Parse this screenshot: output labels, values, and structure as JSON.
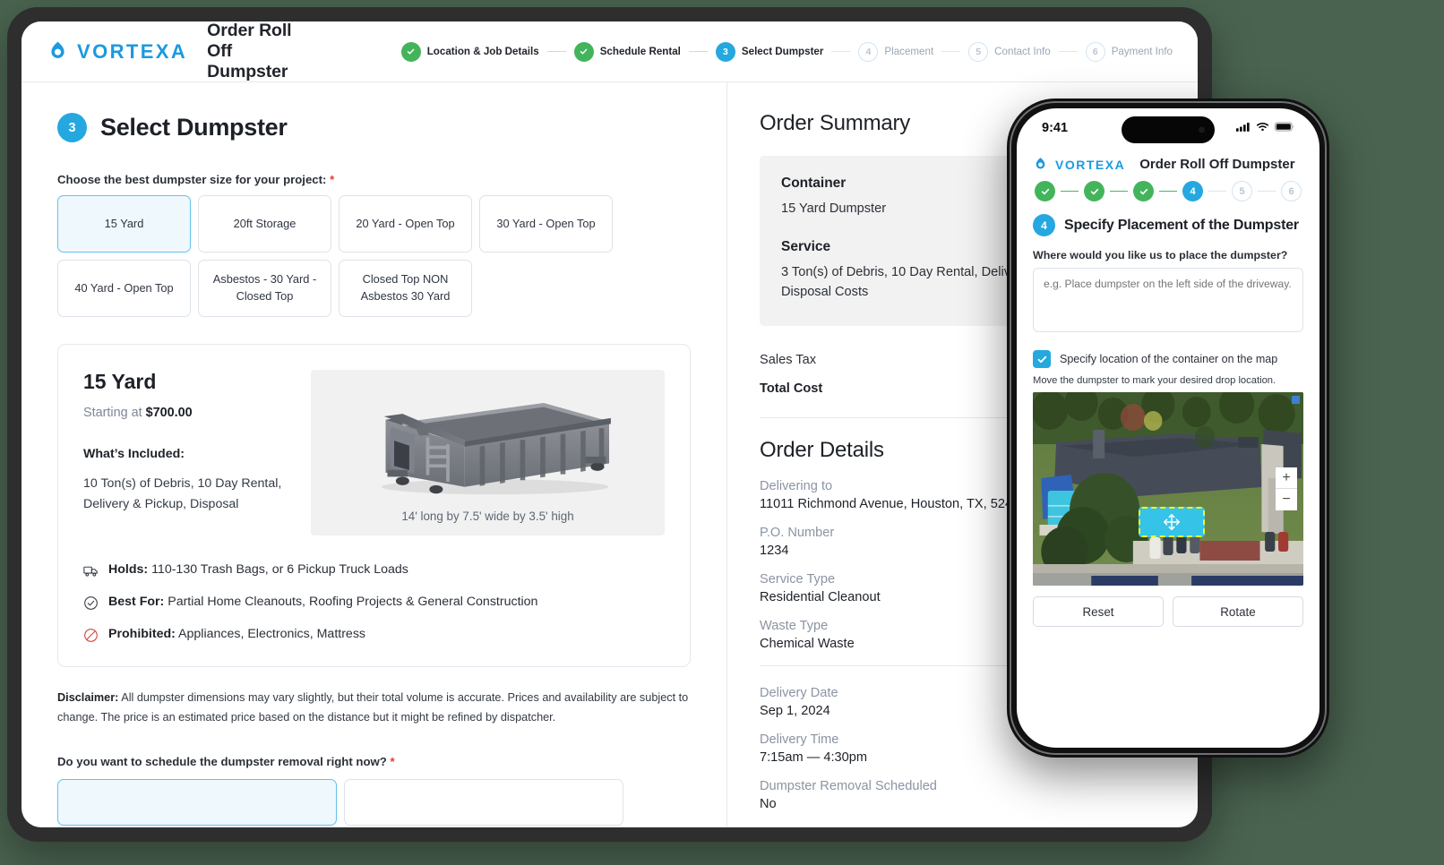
{
  "brand": {
    "name": "VORTEXA",
    "logo_icon": "vortexa-drop-icon"
  },
  "desktop": {
    "app_title": "Order Roll Off Dumpster",
    "stepper": [
      {
        "num": "1",
        "label": "Location & Job Details",
        "state": "done"
      },
      {
        "num": "2",
        "label": "Schedule Rental",
        "state": "done"
      },
      {
        "num": "3",
        "label": "Select Dumpster",
        "state": "current"
      },
      {
        "num": "4",
        "label": "Placement",
        "state": "todo"
      },
      {
        "num": "5",
        "label": "Contact Info",
        "state": "todo"
      },
      {
        "num": "6",
        "label": "Payment Info",
        "state": "todo"
      }
    ],
    "section": {
      "num": "3",
      "title": "Select Dumpster"
    },
    "size_question": "Choose the best dumpster size for your project:",
    "required_mark": "*",
    "sizes": [
      {
        "label": "15 Yard",
        "selected": true
      },
      {
        "label": "20ft Storage",
        "selected": false
      },
      {
        "label": "20 Yard - Open Top",
        "selected": false
      },
      {
        "label": "30 Yard - Open Top",
        "selected": false
      },
      {
        "label": "40 Yard - Open Top",
        "selected": false
      },
      {
        "label": "Asbestos - 30 Yard - Closed Top",
        "selected": false
      },
      {
        "label": "Closed Top NON Asbestos 30 Yard",
        "selected": false
      }
    ],
    "detail": {
      "title": "15 Yard",
      "price_prefix": "Starting at ",
      "price": "$700.00",
      "included_heading": "What’s Included:",
      "included_text": "10 Ton(s) of Debris, 10 Day Rental, Delivery & Pickup, Disposal",
      "dimensions": "14' long by 7.5' wide by 3.5' high",
      "facts": [
        {
          "icon": "truck-icon",
          "key": "Holds:",
          "value": "110-130 Trash Bags, or 6 Pickup Truck Loads"
        },
        {
          "icon": "check-circle-icon",
          "key": "Best For:",
          "value": "Partial Home Cleanouts, Roofing Projects & General Construction"
        },
        {
          "icon": "prohibited-icon",
          "key": "Prohibited:",
          "value": "Appliances, Electronics, Mattress"
        }
      ]
    },
    "disclaimer_label": "Disclaimer:",
    "disclaimer_text": " All dumpster dimensions may vary slightly, but their total volume is accurate. Prices and availability are subject to change. The price is an estimated price based on the distance but it might be refined by dispatcher.",
    "removal_question": "Do you want to schedule the dumpster removal right now?"
  },
  "summary": {
    "heading": "Order Summary",
    "container_key": "Container",
    "container_value": "15 Yard Dumpster",
    "service_key": "Service",
    "service_value": "3 Ton(s) of Debris, 10 Day Rental, Delivery & Pickup, Disposal Costs",
    "sales_tax_label": "Sales Tax",
    "total_label": "Total Cost"
  },
  "order_details": {
    "heading": "Order Details",
    "items": [
      {
        "key": "Delivering to",
        "value": "11011 Richmond Avenue, Houston, TX, 52487"
      },
      {
        "key": "P.O. Number",
        "value": "1234"
      },
      {
        "key": "Service Type",
        "value": "Residential Cleanout"
      },
      {
        "key": "Waste Type",
        "value": "Chemical Waste"
      }
    ],
    "items2": [
      {
        "key": "Delivery Date",
        "value": "Sep 1, 2024"
      },
      {
        "key": "Delivery Time",
        "value": "7:15am — 4:30pm"
      },
      {
        "key": "Dumpster Removal Scheduled",
        "value": "No"
      }
    ]
  },
  "phone": {
    "status_time": "9:41",
    "app_title": "Order Roll Off Dumpster",
    "stepper": [
      {
        "num": "1",
        "state": "done"
      },
      {
        "num": "2",
        "state": "done"
      },
      {
        "num": "3",
        "state": "done"
      },
      {
        "num": "4",
        "state": "current"
      },
      {
        "num": "5",
        "state": "todo"
      },
      {
        "num": "6",
        "state": "todo"
      }
    ],
    "section": {
      "num": "4",
      "title": "Specify Placement of the Dumpster"
    },
    "question": "Where would you like us to place the dumpster?",
    "placeholder": "e.g. Place dumpster on the left side of the driveway.",
    "checkbox_label": "Specify location of the container on the map",
    "checkbox_checked": true,
    "map_hint": "Move the dumpster to mark your desired drop location.",
    "zoom_in": "+",
    "zoom_out": "−",
    "reset_button": "Reset",
    "rotate_button": "Rotate"
  },
  "colors": {
    "brand_blue": "#1b9ae0",
    "accent_blue": "#25a8e0",
    "success_green": "#44b45c",
    "required_red": "#e0412f",
    "marker_cyan": "#36c3e8",
    "marker_outline": "#eef62a",
    "page_background": "#4a6350"
  }
}
